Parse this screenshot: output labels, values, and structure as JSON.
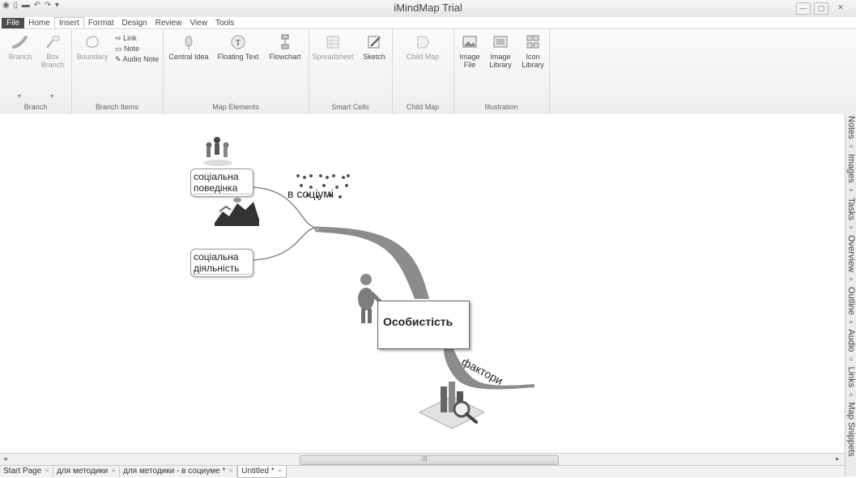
{
  "window": {
    "title": "iMindMap Trial",
    "qat": "◉ ▯ ▬ ↶ ↷ ▾"
  },
  "menu": {
    "items": [
      "File",
      "Home",
      "Insert",
      "Format",
      "Design",
      "Review",
      "View",
      "Tools"
    ],
    "active": "Insert"
  },
  "ribbon": {
    "branch_group": {
      "label": "Branch",
      "branch": "Branch",
      "box_branch_1": "Box",
      "box_branch_2": "Branch"
    },
    "branch_items_group": {
      "label": "Branch Items",
      "boundary": "Boundary",
      "link": "Link",
      "note": "Note",
      "audio_note": "Audio Note"
    },
    "map_elements_group": {
      "label": "Map Elements",
      "central_idea": "Central Idea",
      "floating_text": "Floating Text",
      "flowchart": "Flowchart"
    },
    "smart_cells_group": {
      "label": "Smart Cells",
      "spreadsheet": "Spreadsheet",
      "sketch": "Sketch"
    },
    "child_map_group": {
      "label": "Child Map",
      "child_map": "Child Map"
    },
    "illustration_group": {
      "label": "Illustration",
      "image_file_1": "Image",
      "image_file_2": "File",
      "image_library_1": "Image",
      "image_library_2": "Library",
      "icon_library_1": "Icon",
      "icon_library_2": "Library"
    }
  },
  "map": {
    "central_idea": "Особистість",
    "branch_society": "в соціумі",
    "branch_factors": "фактори",
    "node_behavior_1": "соціальна",
    "node_behavior_2": "поведінка",
    "node_activity_1": "соціальна",
    "node_activity_2": "діяльність"
  },
  "side_panel": {
    "tabs": "Notes ▫ Images ▫ Tasks ▫ Overview ▫ Outline ▫ Audio ▫ Links ▫ Map Snippets"
  },
  "scrollbar": {
    "grip": "III"
  },
  "doc_tabs": {
    "tabs": [
      "Start Page",
      "для методики",
      "для методики - в социуме *",
      "Untitled *"
    ],
    "active": "Untitled *",
    "close_glyph": "×"
  },
  "colors": {
    "branch": "#8a8a8a",
    "branch_dark": "#6e6e6e",
    "file_tab": "#4d4d4d"
  }
}
